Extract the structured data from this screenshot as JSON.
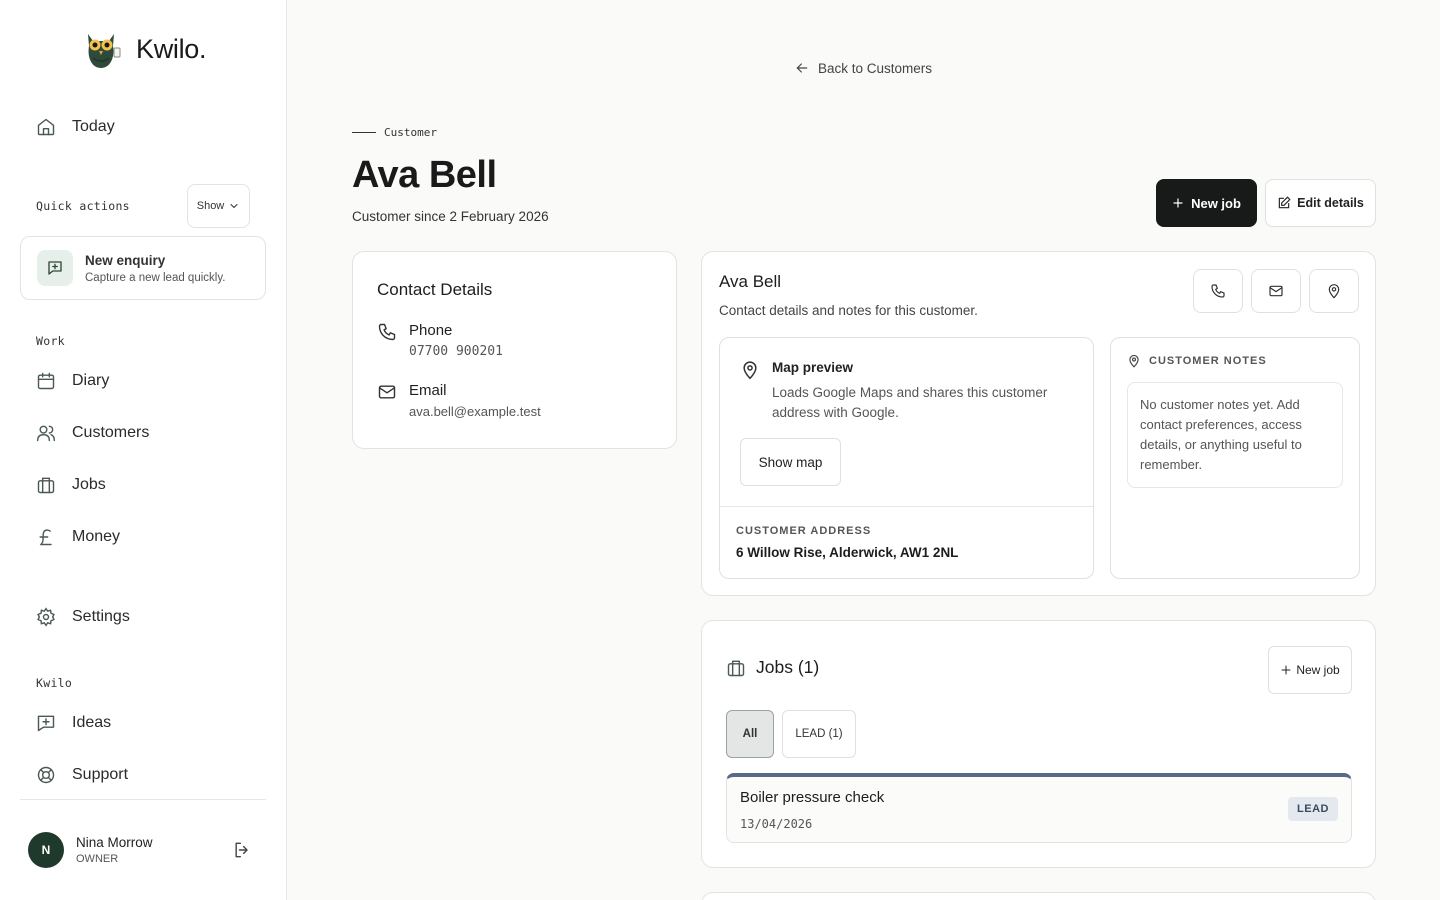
{
  "brand": {
    "name": "Kwilo."
  },
  "sidebar": {
    "today": "Today",
    "quick_actions_label": "Quick actions",
    "quick_actions_toggle": "Show",
    "enquiry": {
      "title": "New enquiry",
      "subtitle": "Capture a new lead quickly."
    },
    "work_label": "Work",
    "work_items": [
      "Diary",
      "Customers",
      "Jobs",
      "Money"
    ],
    "settings": "Settings",
    "kwilo_label": "Kwilo",
    "kwilo_items": [
      "Ideas",
      "Support"
    ],
    "user": {
      "initial": "N",
      "name": "Nina Morrow",
      "role": "OWNER"
    }
  },
  "main": {
    "back_link": "Back to Customers",
    "eyebrow": "Customer",
    "title": "Ava Bell",
    "since": "Customer since 2 February 2026",
    "new_job_button": "New job",
    "edit_button": "Edit details",
    "contact": {
      "heading": "Contact Details",
      "phone_label": "Phone",
      "phone_value": "07700 900201",
      "email_label": "Email",
      "email_value": "ava.bell@example.test"
    },
    "customer_card": {
      "name": "Ava Bell",
      "description": "Contact details and notes for this customer.",
      "map_title": "Map preview",
      "map_description": "Loads Google Maps and shares this customer address with Google.",
      "show_map": "Show map",
      "address_label": "CUSTOMER ADDRESS",
      "address": "6 Willow Rise, Alderwick, AW1 2NL",
      "notes_label": "CUSTOMER NOTES",
      "notes_text": "No customer notes yet. Add contact preferences, access details, or anything useful to remember."
    },
    "jobs": {
      "title": "Jobs (1)",
      "new_job": "New job",
      "filters": [
        "All",
        "LEAD (1)"
      ],
      "items": [
        {
          "name": "Boiler pressure check",
          "date": "13/04/2026",
          "status": "LEAD"
        }
      ]
    }
  },
  "colors": {
    "primary_dark": "#171a18",
    "avatar": "#1f3a2c",
    "lead_bar": "#5a6a86"
  }
}
